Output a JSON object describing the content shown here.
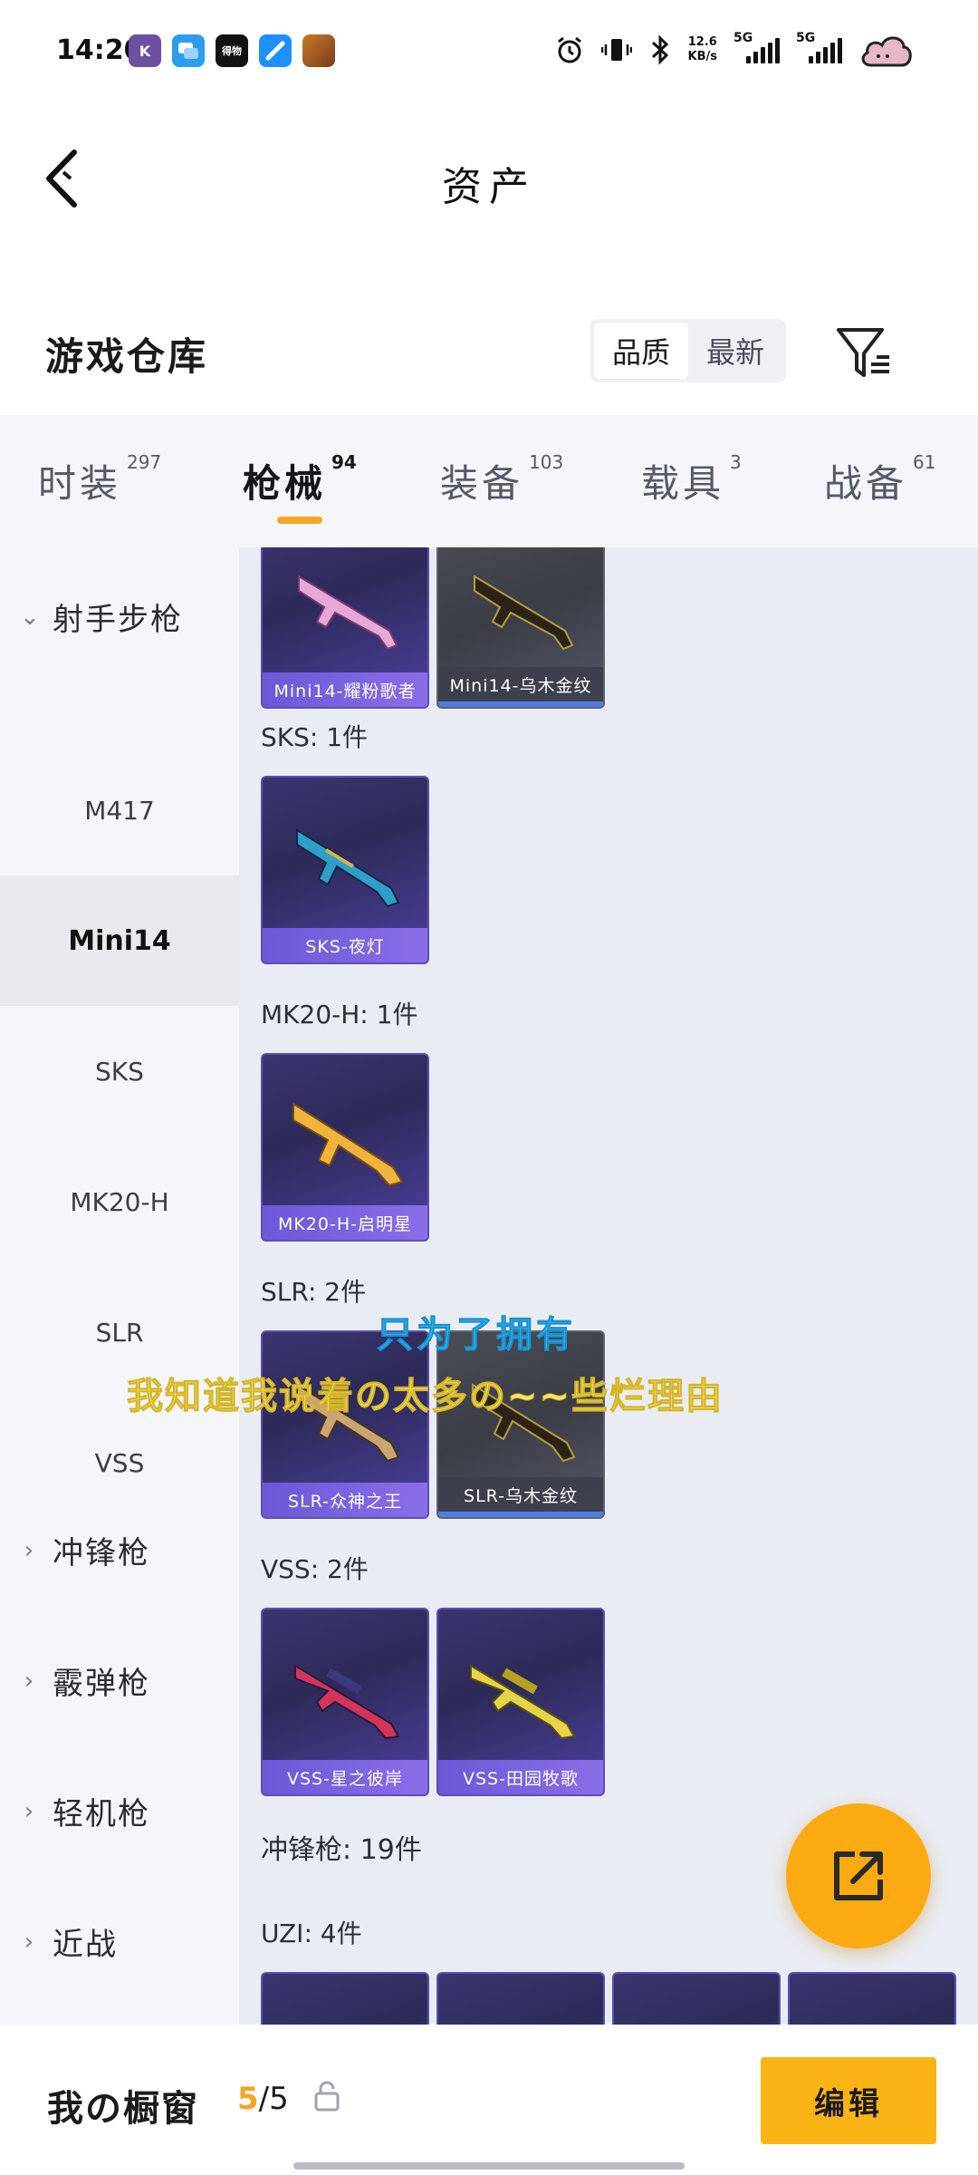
{
  "status_bar": {
    "time": "14:20",
    "apps": [
      {
        "name": "k-app-icon",
        "text": "K",
        "color": "#6b4fa0"
      },
      {
        "name": "chat-app-icon",
        "text": "",
        "color": "#2b9cf0"
      },
      {
        "name": "news-app-icon",
        "text": "得物",
        "color": "#111111"
      },
      {
        "name": "browser-app-icon",
        "text": "",
        "color": "#1e90ff"
      },
      {
        "name": "game-app-icon",
        "text": "",
        "color": "#c77a2a"
      }
    ],
    "net_speed": "12.6",
    "net_unit": "KB/s",
    "signal1_label": "5G",
    "signal2_label": "5G"
  },
  "header": {
    "title": "资产"
  },
  "warehouse": {
    "title": "游戏仓库",
    "sort_options": [
      "品质",
      "最新"
    ],
    "sort_selected": "品质"
  },
  "tabs": [
    {
      "label": "时装",
      "count": "297"
    },
    {
      "label": "枪械",
      "count": "94",
      "active": true
    },
    {
      "label": "装备",
      "count": "103"
    },
    {
      "label": "载具",
      "count": "3"
    },
    {
      "label": "战备",
      "count": "61"
    }
  ],
  "sidebar": {
    "group_expanded": "射手步枪",
    "sub_items": [
      "M417",
      "Mini14",
      "SKS",
      "MK20-H",
      "SLR",
      "VSS"
    ],
    "selected": "Mini14",
    "groups_collapsed": [
      "冲锋枪",
      "霰弹枪",
      "轻机枪",
      "近战"
    ]
  },
  "content": {
    "mini14_cards": [
      "Mini14-耀粉歌者",
      "Mini14-乌木金纹"
    ],
    "sections": [
      {
        "label": "SKS: 1件",
        "cards": [
          "SKS-夜灯"
        ]
      },
      {
        "label": "MK20-H: 1件",
        "cards": [
          "MK20-H-启明星"
        ]
      },
      {
        "label": "SLR: 2件",
        "cards": [
          "SLR-众神之王",
          "SLR-乌木金纹"
        ]
      },
      {
        "label": "VSS: 2件",
        "cards": [
          "VSS-星之彼岸",
          "VSS-田园牧歌"
        ]
      }
    ],
    "category_label": "冲锋枪: 19件",
    "uzi_label": "UZI: 4件"
  },
  "lyrics": {
    "line1": "只为了拥有",
    "line2": "我知道我说着の太多の~~些烂理由"
  },
  "bottom_bar": {
    "title": "我の橱窗",
    "count_current": "5",
    "count_total": "/5",
    "edit_label": "编辑"
  },
  "colors": {
    "accent": "#f6a623",
    "fab": "#fbab11",
    "card_purple": "#3b3570",
    "card_gray": "#4a4c56"
  }
}
